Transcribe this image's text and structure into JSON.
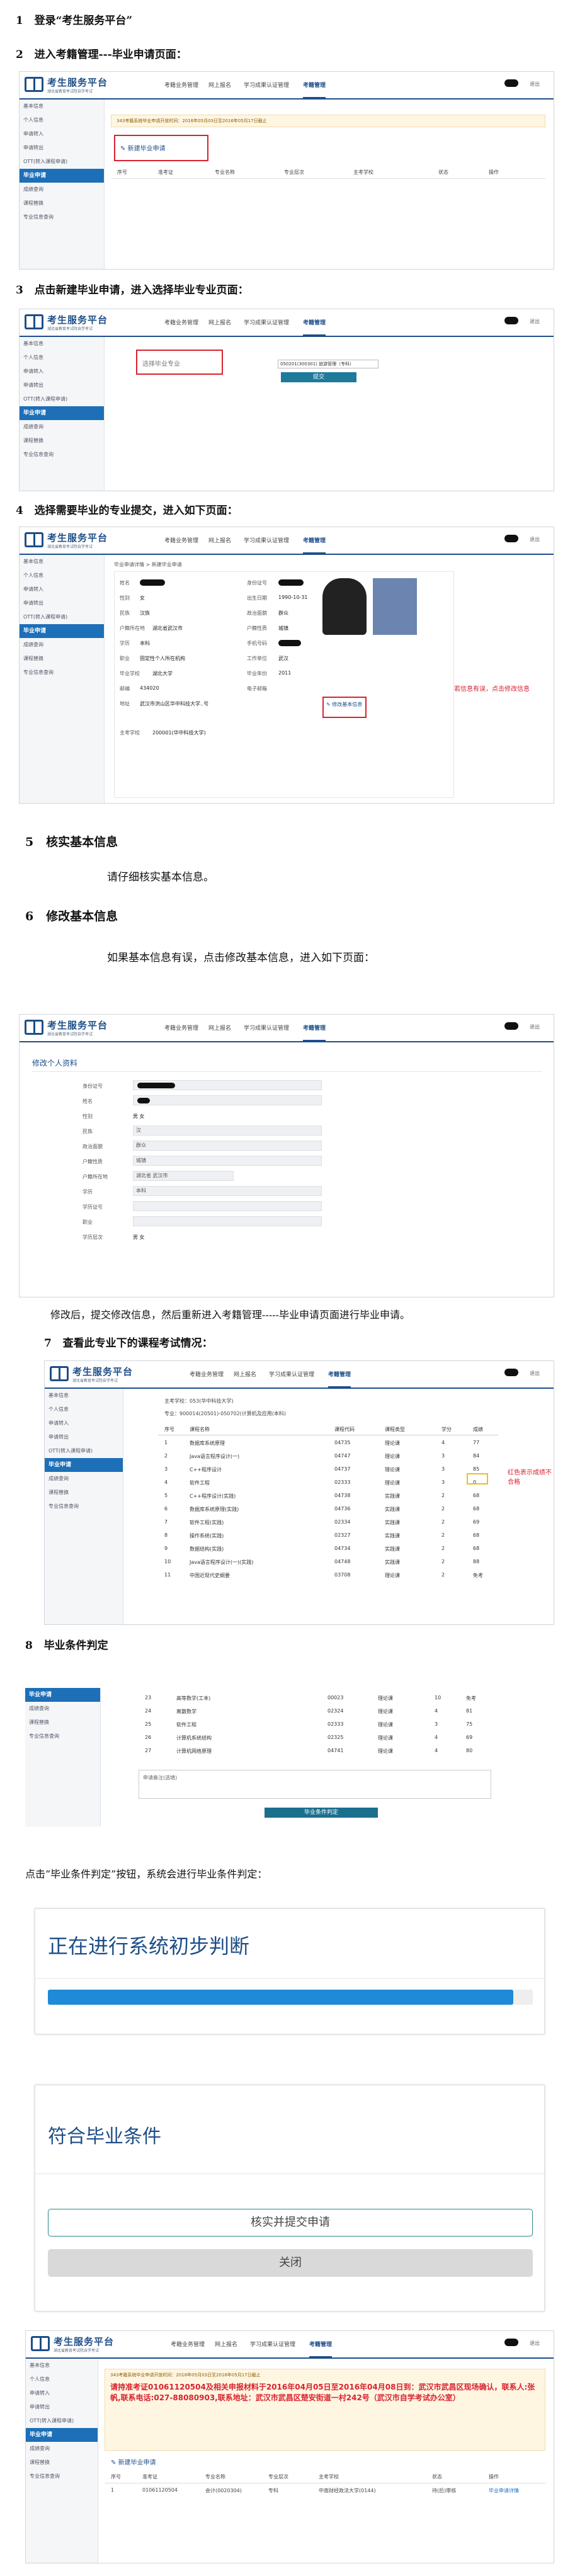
{
  "steps": [
    {
      "num": "1",
      "title": "登录“考生服务平台”"
    },
    {
      "num": "2",
      "title": "进入考籍管理---毕业申请页面："
    },
    {
      "num": "3",
      "title": "点击新建毕业申请，进入选择毕业专业页面："
    },
    {
      "num": "4",
      "title": "选择需要毕业的专业提交，进入如下页面："
    },
    {
      "num": "5",
      "title": "核实基本信息"
    },
    {
      "num": "6",
      "title": "修改基本信息"
    },
    {
      "num": "7",
      "title": "查看此专业下的课程考试情况："
    },
    {
      "num": "8",
      "title": "毕业条件判定"
    }
  ],
  "paras": {
    "p5": "请仔细核实基本信息。",
    "p6": "如果基本信息有误，点击修改基本信息，进入如下页面：",
    "p6b": "修改后，提交修改信息，然后重新进入考籍管理-----毕业申请页面进行毕业申请。",
    "p8": "点击“毕业条件判定”按钮，系统会进行毕业条件判定："
  },
  "app": {
    "logo_title": "考生服务平台",
    "logo_sub": "湖北省教育考试院自学考试",
    "nav": [
      "考籍业务管理",
      "网上报名",
      "学习成果认证管理",
      "考籍管理"
    ],
    "exit": "退出",
    "sidebar": [
      "基本信息",
      "个人信息",
      "申请转入",
      "申请转出",
      "OTT(转入课程申请)",
      "毕业申请",
      "成绩查询",
      "课程替换",
      "专业信息查询"
    ],
    "sidebar_active": "毕业申请"
  },
  "s2": {
    "notice": "343考籍系统毕业申请开放时间：2016年05月03日至2016年05月17日截止",
    "new_btn": "新建毕业申请",
    "cols": [
      "序号",
      "准考证",
      "专业名称",
      "专业层次",
      "主考学校",
      "状态",
      "操作"
    ]
  },
  "s3": {
    "placeholder": "选择毕业专业",
    "select_val": "050201(300301) 旅游管理（专科）",
    "submit": "提交"
  },
  "s4": {
    "crumb": "毕业申请详情 > 新建毕业申请",
    "labels": [
      "姓名",
      "性别",
      "民族",
      "户籍所在地",
      "学历",
      "职业",
      "毕业学校",
      "邮编",
      "地址",
      "主考学校"
    ],
    "values": [
      "",
      "女",
      "汉族",
      "湖北省武汉市",
      "本科",
      "固定性个人所在机构",
      "湖北大学",
      "434020",
      "武汉市洪山区华中科技大学..号",
      "200001(华中科技大学)"
    ],
    "labels2": [
      "身份证号",
      "出生日期",
      "政治面貌",
      "户籍性质",
      "手机号码",
      "工作单位",
      "毕业年份",
      "电子邮箱"
    ],
    "values2": [
      "",
      "1990-10-31",
      "群众",
      "城镇",
      "",
      "武汉",
      "2011",
      ""
    ],
    "modify_btn": "修改基本信息",
    "annot": "若信息有误，点击修改信息"
  },
  "s6": {
    "title": "修改个人资料",
    "fields": [
      "身份证号",
      "姓名",
      "性别",
      "民族",
      "政治面貌",
      "户籍性质",
      "户籍所在地",
      "学历",
      "学历证号",
      "职业",
      "学历层次"
    ],
    "vals": [
      "",
      "",
      "男  女",
      "汉",
      "群众",
      "城镇",
      "湖北省  武汉市",
      "本科",
      "",
      "",
      "男  女"
    ]
  },
  "s7": {
    "info1": "主考学校：053(华中科技大学)",
    "info2": "专业：900014(20501)-050702(计算机及应用(本科)",
    "cols": [
      "序号",
      "课程名称",
      "课程代码",
      "课程类型",
      "学分",
      "成绩"
    ],
    "rows": [
      [
        "1",
        "数据库系统原理",
        "04735",
        "理论课",
        "4",
        "77"
      ],
      [
        "2",
        "Java语言程序设计(一)",
        "04747",
        "理论课",
        "3",
        "84"
      ],
      [
        "3",
        "C++程序设计",
        "04737",
        "理论课",
        "3",
        "85"
      ],
      [
        "4",
        "软件工程",
        "02333",
        "理论课",
        "3",
        "0"
      ],
      [
        "5",
        "C++程序设计(实践)",
        "04738",
        "实践课",
        "2",
        "68"
      ],
      [
        "6",
        "数据库系统原理(实践)",
        "04736",
        "实践课",
        "2",
        "68"
      ],
      [
        "7",
        "软件工程(实践)",
        "02334",
        "实践课",
        "2",
        "69"
      ],
      [
        "8",
        "操作系统(实践)",
        "02327",
        "实践课",
        "2",
        "68"
      ],
      [
        "9",
        "数据结构(实践)",
        "04734",
        "实践课",
        "2",
        "68"
      ],
      [
        "10",
        "Java语言程序设计(一)(实践)",
        "04748",
        "实践课",
        "2",
        "88"
      ],
      [
        "11",
        "中国近现代史纲要",
        "03708",
        "理论课",
        "2",
        "免考"
      ]
    ],
    "annot": "红色表示成绩不合格"
  },
  "s8": {
    "rows": [
      [
        "23",
        "高等数学(工本)",
        "00023",
        "理论课",
        "10",
        "免考"
      ],
      [
        "24",
        "离散数学",
        "02324",
        "理论课",
        "4",
        "81"
      ],
      [
        "25",
        "软件工程",
        "02333",
        "理论课",
        "3",
        "75"
      ],
      [
        "26",
        "计算机系统结构",
        "02325",
        "理论课",
        "4",
        "69"
      ],
      [
        "27",
        "计算机网络原理",
        "04741",
        "理论课",
        "4",
        "80"
      ]
    ],
    "remark": "申请备注(选填)",
    "judge_btn": "毕业条件判定"
  },
  "m1": {
    "text": "正在进行系统初步判断"
  },
  "m2": {
    "text": "符合毕业条件",
    "btn1": "核实并提交申请",
    "btn2": "关闭"
  },
  "s9": {
    "notice": "343考籍系统毕业申请开放时间：2016年05月03日至2016年05月17日截止",
    "red": "请持准考证01061120504及相关申报材料于2016年04月05日至2016年04月08日到：武汉市武昌区现场确认，联系人:张帆,联系电话:027-88080903,联系地址：武汉市武昌区楚安街道一村242号（武汉市自学考试办公室）",
    "new_btn": "新建毕业申请",
    "cols": [
      "序号",
      "准考证",
      "专业名称",
      "专业层次",
      "主考学校",
      "状态",
      "操作"
    ],
    "row": [
      "1",
      "01061120504",
      "会计(0020304)",
      "专科",
      "中南财经政法大学(0144)",
      "待(后)审核",
      "毕业申请详情"
    ]
  }
}
